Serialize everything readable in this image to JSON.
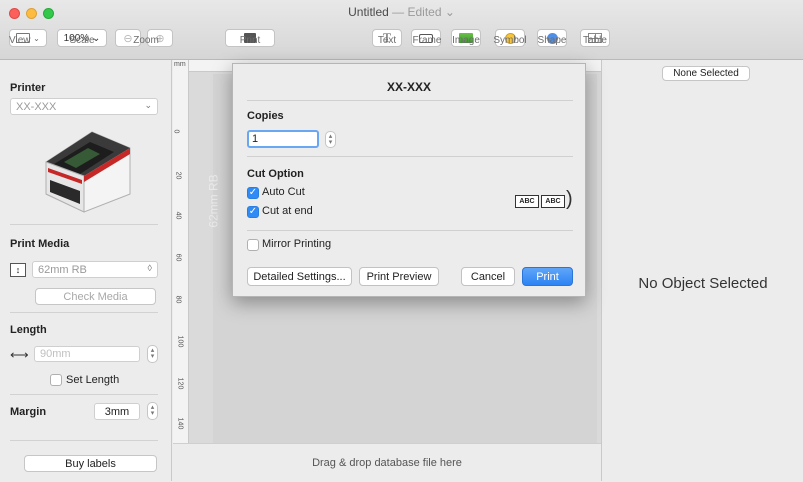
{
  "window": {
    "title": "Untitled",
    "title_status": "— Edited ⌄"
  },
  "toolbar": {
    "view_label": "View",
    "scale_value": "100% ⌄",
    "scale_label": "Scale",
    "zoom_label": "Zoom",
    "print_label": "Print",
    "text_label": "Text",
    "frame_label": "Frame",
    "image_label": "Image",
    "symbol_label": "Symbol",
    "shape_label": "Shape",
    "table_label": "Table"
  },
  "sidebar": {
    "printer_title": "Printer",
    "printer_value": "XX-XXX",
    "media_title": "Print Media",
    "media_value": "62mm RB",
    "check_media": "Check Media",
    "length_title": "Length",
    "length_value": "90mm",
    "set_length": "Set Length",
    "margin_title": "Margin",
    "margin_value": "3mm",
    "buy_labels": "Buy labels"
  },
  "canvas": {
    "ruler_unit": "mm",
    "ruler_marks": [
      "0",
      "20",
      "40",
      "60",
      "80",
      "100",
      "120",
      "140"
    ],
    "label_media_text": "62mm RB",
    "drop_hint": "Drag & drop database file here"
  },
  "inspector": {
    "selection_button": "None Selected",
    "empty_text": "No Object Selected"
  },
  "dialog": {
    "title": "XX-XXX",
    "copies_title": "Copies",
    "copies_value": "1",
    "cut_title": "Cut Option",
    "auto_cut": "Auto Cut",
    "cut_at_end": "Cut at end",
    "abc": "ABC",
    "mirror": "Mirror Printing",
    "detailed": "Detailed Settings...",
    "preview": "Print Preview",
    "cancel": "Cancel",
    "print": "Print",
    "accent": "#2d83f4"
  }
}
